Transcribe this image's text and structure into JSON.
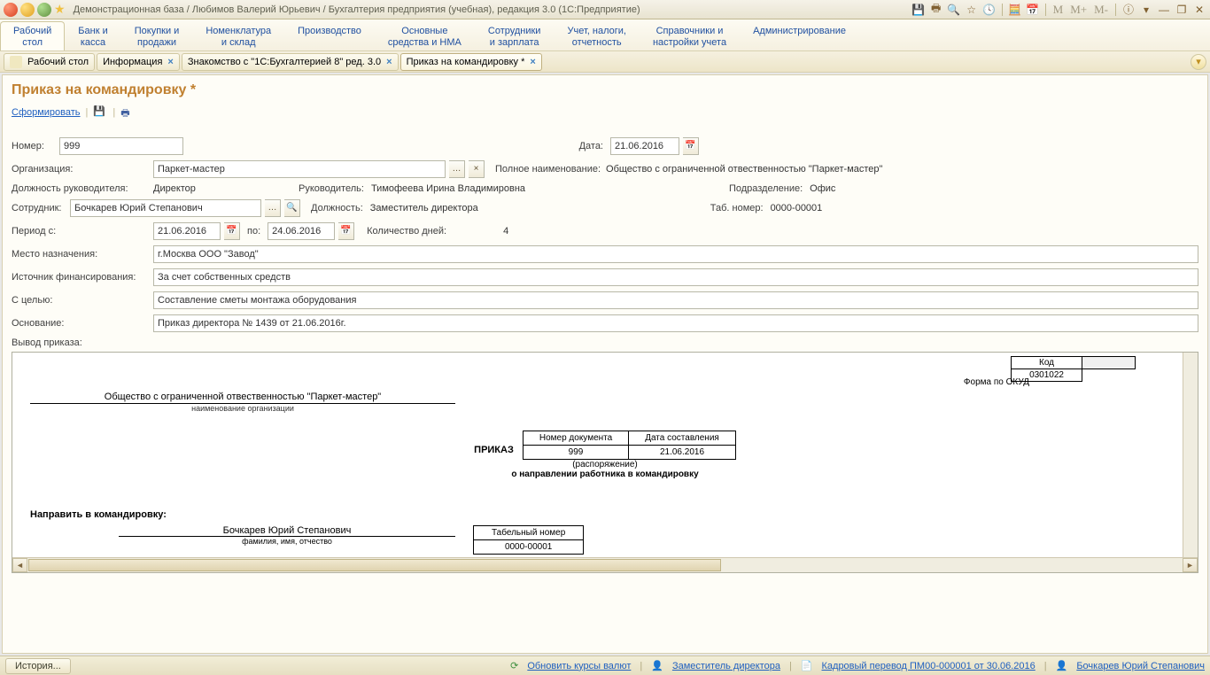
{
  "title": "Демонстрационная база / Любимов Валерий Юрьевич / Бухгалтерия предприятия (учебная), редакция 3.0  (1С:Предприятие)",
  "nav": {
    "items": [
      "Рабочий\nстол",
      "Банк и\nкасса",
      "Покупки и\nпродажи",
      "Номенклатура\nи склад",
      "Производство",
      "Основные\nсредства и НМА",
      "Сотрудники\nи зарплата",
      "Учет, налоги,\nотчетность",
      "Справочники и\nнастройки учета",
      "Администрирование"
    ]
  },
  "tabs": [
    {
      "label": "Рабочий стол"
    },
    {
      "label": "Информация"
    },
    {
      "label": "Знакомство с \"1С:Бухгалтерией 8\" ред. 3.0"
    },
    {
      "label": "Приказ на командировку *",
      "active": true
    }
  ],
  "doc_title": "Приказ на командировку *",
  "toolbar": {
    "form": "Сформировать"
  },
  "form": {
    "number_lbl": "Номер:",
    "number": "999",
    "date_lbl": "Дата:",
    "date": "21.06.2016",
    "org_lbl": "Организация:",
    "org": "Паркет-мастер",
    "fullname_lbl": "Полное наименование:",
    "fullname": "Общество с ограниченной отвественностью \"Паркет-мастер\"",
    "pos_lbl": "Должность руководителя:",
    "pos": "Директор",
    "head_lbl": "Руководитель:",
    "head": "Тимофеева Ирина Владимировна",
    "dept_lbl": "Подразделение:",
    "dept": "Офис",
    "emp_lbl": "Сотрудник:",
    "emp": "Бочкарев Юрий Степанович",
    "emppos_lbl": "Должность:",
    "emppos": "Заместитель директора",
    "tabnum_lbl": "Таб. номер:",
    "tabnum": "0000-00001",
    "period_lbl": "Период с:",
    "period_from": "21.06.2016",
    "period_to_lbl": "по:",
    "period_to": "24.06.2016",
    "days_lbl": "Количество дней:",
    "days": "4",
    "dest_lbl": "Место назначения:",
    "dest": "г.Москва ООО \"Завод\"",
    "fin_lbl": "Источник финансирования:",
    "fin": "За счет собственных средств",
    "goal_lbl": "С целью:",
    "goal": "Составление сметы монтажа оборудования",
    "basis_lbl": "Основание:",
    "basis": "Приказ директора № 1439 от 21.06.2016г.",
    "output_lbl": "Вывод приказа:"
  },
  "doc": {
    "okud_lbl": "Форма по ОКУД",
    "okud_code_hdr": "Код",
    "okud_code": "0301022",
    "org": "Общество с ограниченной отвественностью \"Паркет-мастер\"",
    "org_sub": "наименование организации",
    "docnum_hdr": "Номер документа",
    "docdate_hdr": "Дата составления",
    "docnum": "999",
    "docdate": "21.06.2016",
    "prikaz": "ПРИКАЗ",
    "prikaz_sub": "(распоряжение)",
    "prikaz_sub2": "о направлении работника в командировку",
    "send": "Направить в командировку:",
    "emp": "Бочкарев Юрий Степанович",
    "emp_sub": "фамилия, имя, отчество",
    "tabnum_hdr": "Табельный номер",
    "tabnum": "0000-00001"
  },
  "status": {
    "history": "История...",
    "rates": "Обновить курсы валют",
    "dep": "Заместитель директора",
    "transfer": "Кадровый перевод ПМ00-000001 от 30.06.2016",
    "emp": "Бочкарев Юрий Степанович"
  }
}
